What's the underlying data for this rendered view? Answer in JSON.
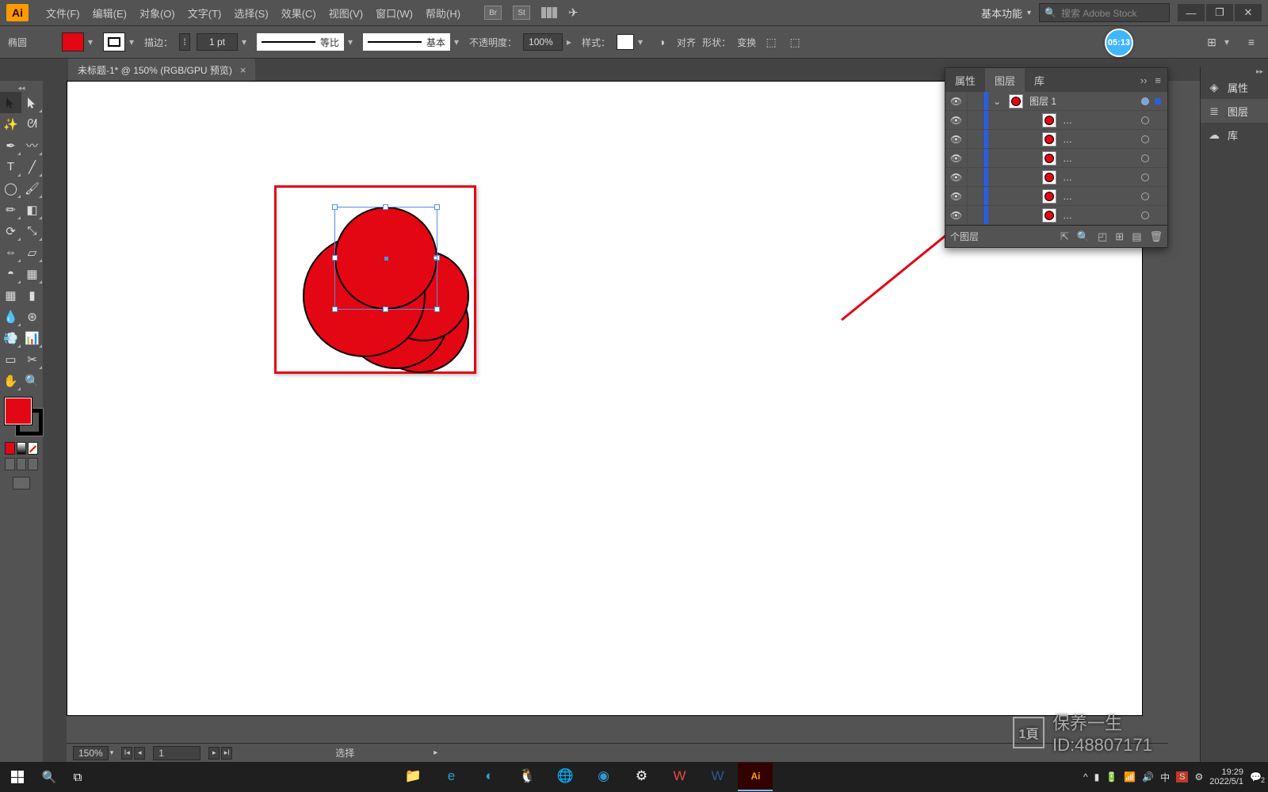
{
  "app": {
    "logo_text": "Ai"
  },
  "menu": {
    "file": "文件(F)",
    "edit": "编辑(E)",
    "object": "对象(O)",
    "type": "文字(T)",
    "select": "选择(S)",
    "effect": "效果(C)",
    "view": "视图(V)",
    "window": "窗口(W)",
    "help": "帮助(H)"
  },
  "workspace": {
    "name": "基本功能"
  },
  "search": {
    "placeholder": "搜索 Adobe Stock"
  },
  "timer": {
    "value": "05:13"
  },
  "control": {
    "tool_label": "椭圆",
    "stroke_label": "描边：",
    "stroke_weight": "1 pt",
    "profile_label": "等比",
    "brush_label": "基本",
    "opacity_label": "不透明度：",
    "opacity_value": "100%",
    "style_label": "样式：",
    "align_label": "对齐",
    "shape_label": "形状：",
    "transform_label": "变换"
  },
  "tab": {
    "title": "未标题-1* @ 150% (RGB/GPU 预览)"
  },
  "layers_panel": {
    "tabs": {
      "properties": "属性",
      "layers": "图层",
      "libraries": "库"
    },
    "parent_layer": "图层 1",
    "sublayer_label": "…",
    "footer_label": "个图层"
  },
  "rightdock": {
    "properties": "属性",
    "layers": "图层",
    "libraries": "库"
  },
  "status": {
    "zoom": "150%",
    "artboard": "1",
    "hint": "选择"
  },
  "taskbar": {
    "ime": "中",
    "time": "19:29",
    "date": "2022/5/1",
    "notif_count": "2"
  },
  "watermark": {
    "line1": "保养一生",
    "line2": "ID:48807171",
    "icon": "1頁"
  },
  "colors": {
    "accent_red": "#e30613",
    "sel_blue": "#2b5fd9"
  }
}
